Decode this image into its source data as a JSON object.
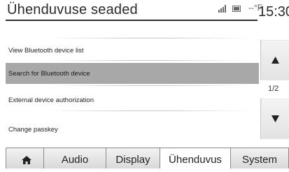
{
  "header": {
    "title": "Ühenduvuse seaded",
    "status_text": "--°F",
    "clock": "15:30"
  },
  "icons": {
    "signal": "signal-icon",
    "battery": "battery-icon",
    "home": "home-icon",
    "up": "arrow-up-icon",
    "down": "arrow-down-icon"
  },
  "menu": {
    "items": [
      {
        "label": "View Bluetooth device list"
      },
      {
        "label": "Search for Bluetooth device",
        "selected": true
      },
      {
        "label": "External device authorization"
      },
      {
        "label": "Change passkey"
      }
    ]
  },
  "pager": {
    "indicator": "1/2"
  },
  "tabs": [
    {
      "label": ""
    },
    {
      "label": "Audio"
    },
    {
      "label": "Display"
    },
    {
      "label": "Ühenduvus",
      "active": true
    },
    {
      "label": "System"
    }
  ],
  "colors": {
    "selected_row": "#a8a8a8",
    "arrow": "#222222"
  }
}
